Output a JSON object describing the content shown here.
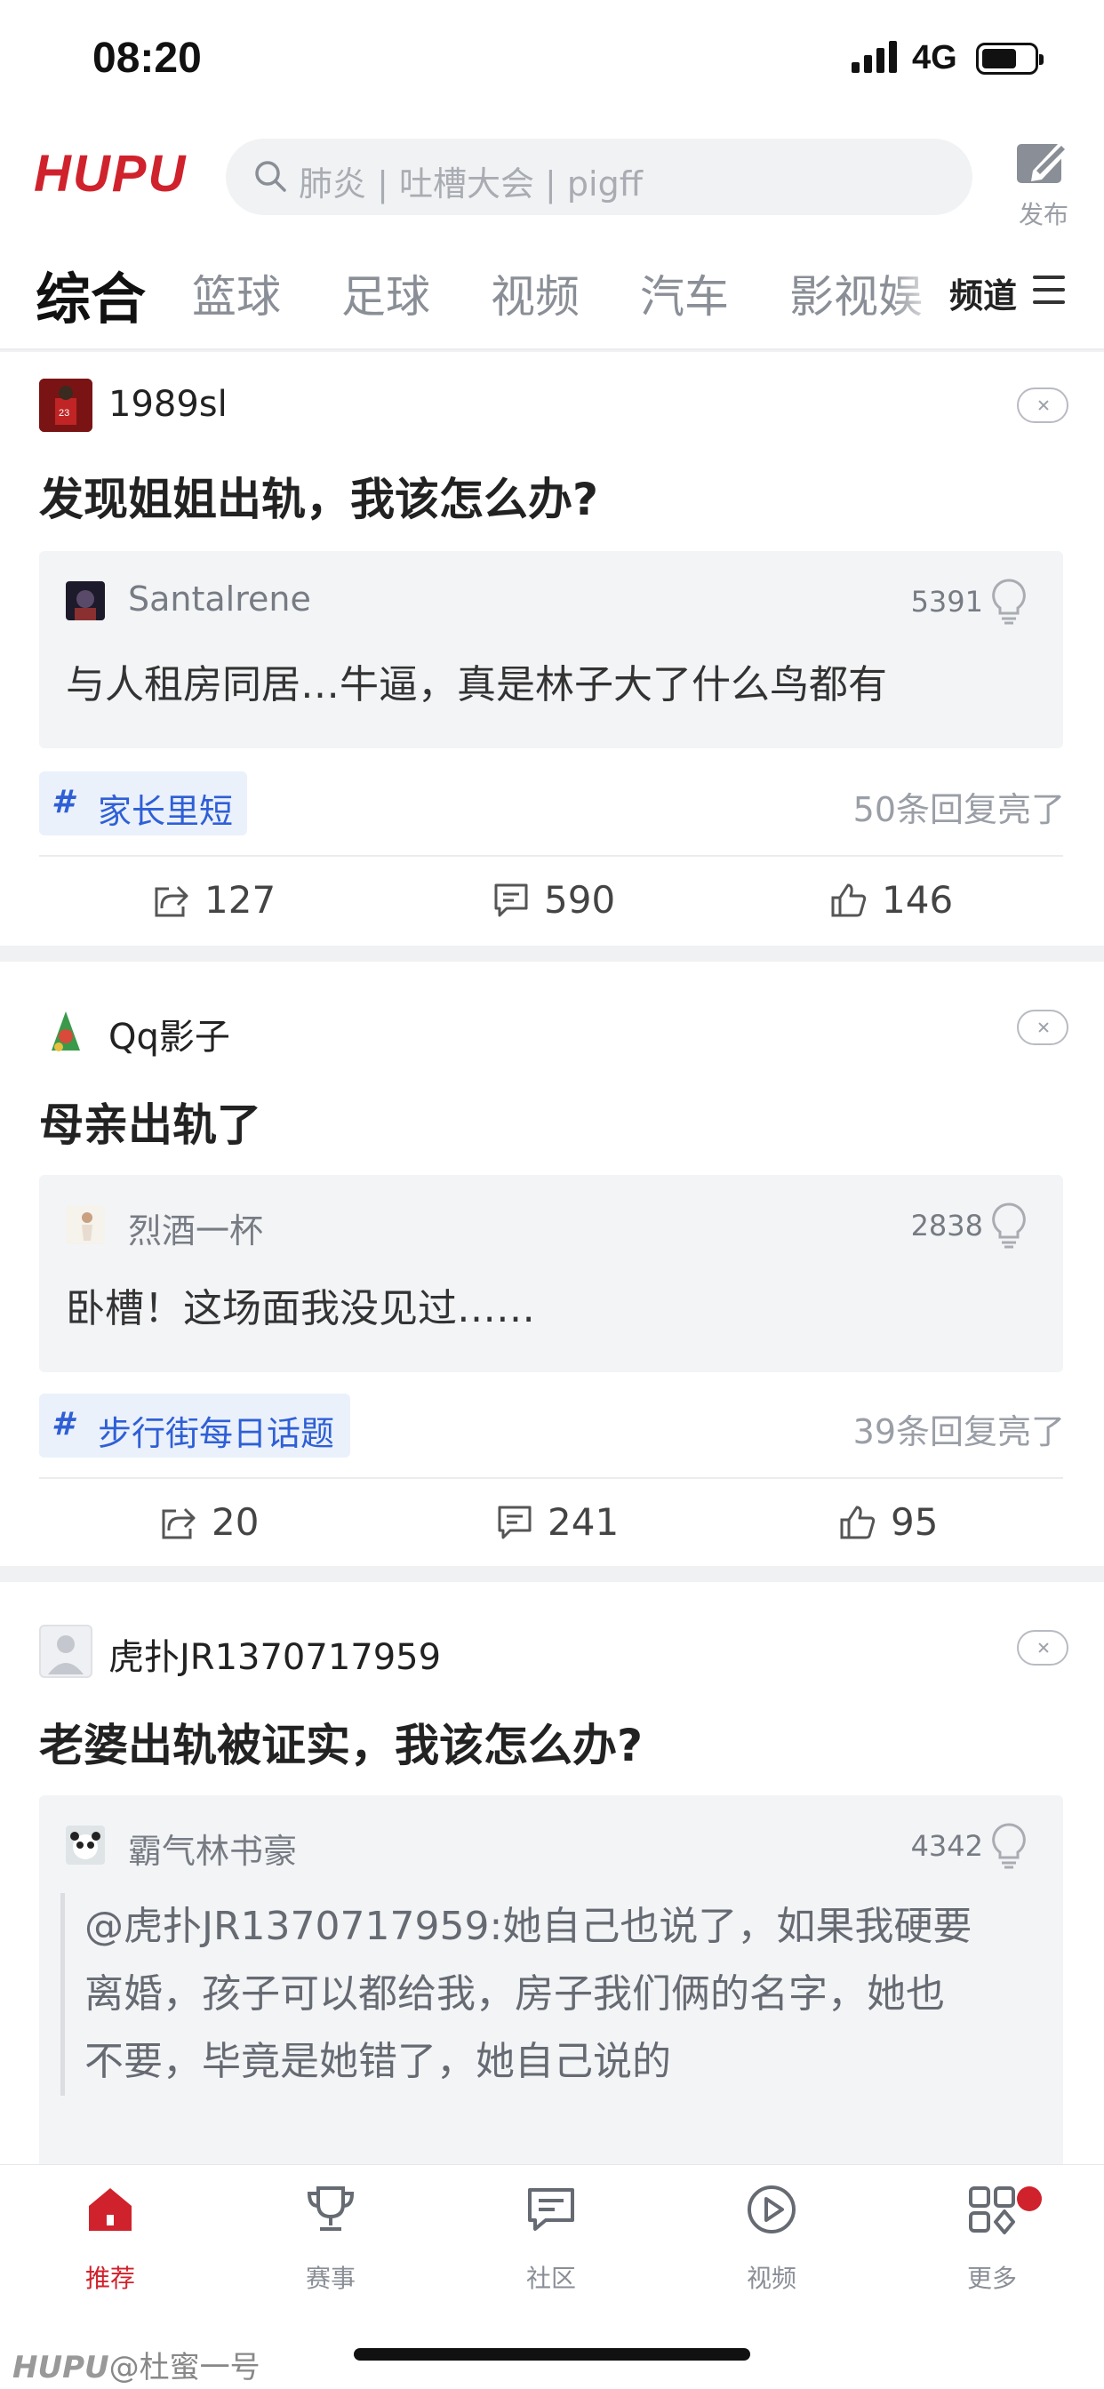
{
  "status": {
    "time": "08:20",
    "network": "4G"
  },
  "header": {
    "logo": "HUPU",
    "search_placeholder": "肺炎 | 吐槽大会 | pigff",
    "publish_label": "发布"
  },
  "tabs": [
    {
      "label": "综合",
      "active": true
    },
    {
      "label": "篮球"
    },
    {
      "label": "足球"
    },
    {
      "label": "视频"
    },
    {
      "label": "汽车"
    },
    {
      "label": "影视娱乐"
    }
  ],
  "channel_label": "频道",
  "posts": [
    {
      "author": "1989sl",
      "title": "发现姐姐出轨，我该怎么办?",
      "reply": {
        "author": "Santalrene",
        "likes": "5391",
        "text": "与人租房同居…牛逼，真是林子大了什么鸟都有"
      },
      "tag": "家长里短",
      "lit": "50条回复亮了",
      "share": "127",
      "comments": "590",
      "likes": "146"
    },
    {
      "author": "Qq影子",
      "title": "母亲出轨了",
      "reply": {
        "author": "烈酒一杯",
        "likes": "2838",
        "text": "卧槽！这场面我没见过……"
      },
      "tag": "步行街每日话题",
      "lit": "39条回复亮了",
      "share": "20",
      "comments": "241",
      "likes": "95"
    },
    {
      "author": "虎扑JR1370717959",
      "title": "老婆出轨被证实，我该怎么办?",
      "reply": {
        "author": "霸气林书豪",
        "likes": "4342",
        "quote_lines": [
          "@虎扑JR1370717959:她自己也说了，如果我硬要",
          "离婚，孩子可以都给我，房子我们俩的名字，她也",
          "不要，毕竟是她错了，她自己说的"
        ]
      }
    }
  ],
  "bottom_nav": [
    {
      "label": "推荐",
      "icon": "home-icon",
      "active": true
    },
    {
      "label": "赛事",
      "icon": "trophy-icon"
    },
    {
      "label": "社区",
      "icon": "chat-icon"
    },
    {
      "label": "视频",
      "icon": "play-icon"
    },
    {
      "label": "更多",
      "icon": "grid-icon"
    }
  ],
  "watermark": {
    "brand": "HUPU",
    "text": "@杜蜜一号"
  },
  "colors": {
    "brand_red": "#d0222c",
    "tag_blue": "#2f5fd6",
    "tag_bg": "#eaf1fb"
  }
}
